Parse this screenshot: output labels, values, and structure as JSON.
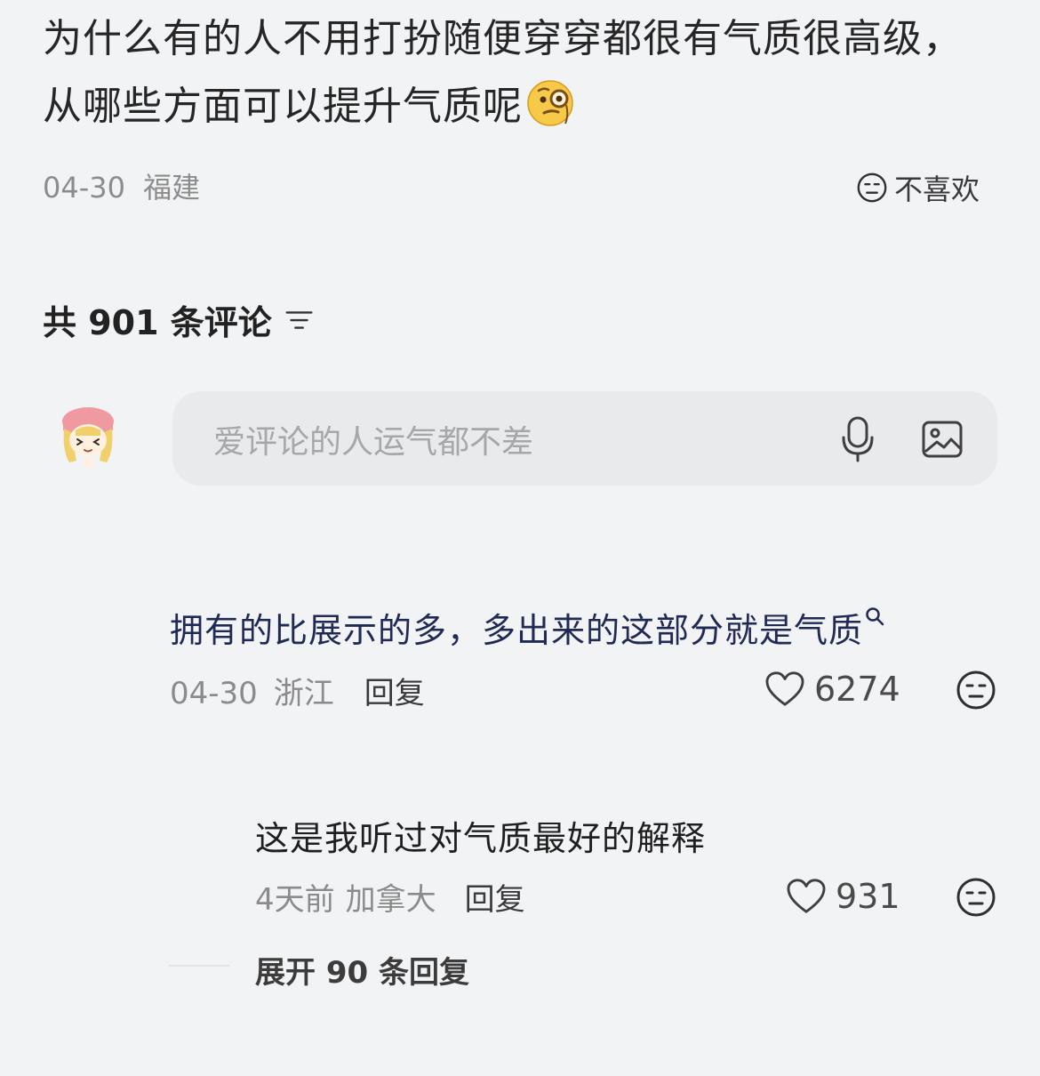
{
  "post": {
    "title": "为什么有的人不用打扮随便穿穿都很有气质很高级，从哪些方面可以提升气质呢",
    "title_emoji": "thinking-monocle-emoji",
    "date": "04-30",
    "location": "福建",
    "dislike_label": "不喜欢"
  },
  "comments_section": {
    "count_label": "共 901 条评论",
    "filter_icon": "sort-filter-icon",
    "composer": {
      "placeholder": "爱评论的人运气都不差",
      "mic_icon": "microphone-icon",
      "image_icon": "image-icon",
      "avatar": "avatar"
    },
    "items": [
      {
        "text": "拥有的比展示的多，多出来的这部分就是气质",
        "date": "04-30",
        "location": "浙江",
        "reply_label": "回复",
        "likes": "6274"
      }
    ],
    "replies": [
      {
        "text": "这是我听过对气质最好的解释",
        "date": "4天前",
        "location": "加拿大",
        "reply_label": "回复",
        "likes": "931"
      }
    ],
    "expand_label": "展开 90 条回复"
  },
  "colors": {
    "background": "#f2f3f5",
    "comment_blue": "#202a55",
    "meta_gray": "#8b8b8b",
    "composer_bg": "#e9eaec"
  }
}
